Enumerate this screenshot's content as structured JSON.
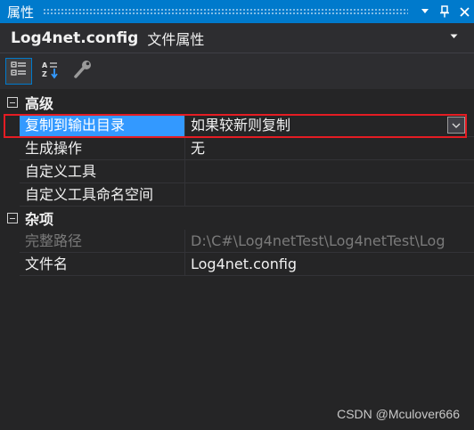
{
  "window": {
    "title": "属性"
  },
  "object_selector": {
    "name": "Log4net.config",
    "type": "文件属性"
  },
  "toolbar": {
    "buttons": [
      "categorized-icon",
      "alphabetical-icon",
      "property-pages-icon"
    ]
  },
  "categories": [
    {
      "name": "高级",
      "properties": [
        {
          "name": "复制到输出目录",
          "value": "如果较新则复制",
          "selected": true,
          "disabled": false
        },
        {
          "name": "生成操作",
          "value": "无",
          "selected": false,
          "disabled": false
        },
        {
          "name": "自定义工具",
          "value": "",
          "selected": false,
          "disabled": false
        },
        {
          "name": "自定义工具命名空间",
          "value": "",
          "selected": false,
          "disabled": false
        }
      ]
    },
    {
      "name": "杂项",
      "properties": [
        {
          "name": "完整路径",
          "value": "D:\\C#\\Log4netTest\\Log4netTest\\Log",
          "selected": false,
          "disabled": true
        },
        {
          "name": "文件名",
          "value": "Log4net.config",
          "selected": false,
          "disabled": false
        }
      ]
    }
  ],
  "watermark": "CSDN @Mculover666",
  "colors": {
    "title_bar": "#007acc",
    "selection": "#3399ff",
    "highlight_outline": "#e51c23",
    "background": "#252526"
  }
}
